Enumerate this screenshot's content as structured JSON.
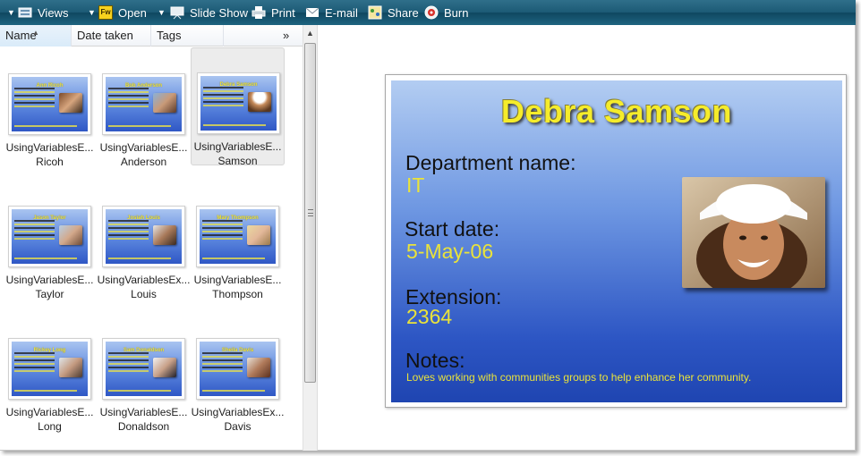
{
  "toolbar": {
    "views_label": "Views",
    "open_label": "Open",
    "slideshow_label": "Slide Show",
    "print_label": "Print",
    "email_label": "E-mail",
    "share_label": "Share",
    "burn_label": "Burn",
    "open_icon_text": "Fw"
  },
  "columns": {
    "name": "Name",
    "date_taken": "Date taken",
    "tags": "Tags",
    "more": "»"
  },
  "files": [
    {
      "line1": "UsingVariablesE...",
      "line2": "Ricoh",
      "thumb_name": "Ann Ricoh",
      "selected": false
    },
    {
      "line1": "UsingVariablesE...",
      "line2": "Anderson",
      "thumb_name": "Bob Anderson",
      "selected": false
    },
    {
      "line1": "UsingVariablesE...",
      "line2": "Samson",
      "thumb_name": "Debra Samson",
      "selected": true
    },
    {
      "line1": "UsingVariablesE...",
      "line2": "Taylor",
      "thumb_name": "Jason Taylor",
      "selected": false
    },
    {
      "line1": "UsingVariablesEx...",
      "line2": "Louis",
      "thumb_name": "Josiah Louis",
      "selected": false
    },
    {
      "line1": "UsingVariablesE...",
      "line2": "Thompson",
      "thumb_name": "Mary Thompson",
      "selected": false
    },
    {
      "line1": "UsingVariablesE...",
      "line2": "Long",
      "thumb_name": "Rickey Long",
      "selected": false
    },
    {
      "line1": "UsingVariablesE...",
      "line2": "Donaldson",
      "thumb_name": "Sam Donaldson",
      "selected": false
    },
    {
      "line1": "UsingVariablesEx...",
      "line2": "Davis",
      "thumb_name": "Sheila Davis",
      "selected": false
    }
  ],
  "preview": {
    "name": "Debra Samson",
    "department_label": "Department name:",
    "department_value": "IT",
    "start_label": "Start date:",
    "start_value": "5-May-06",
    "extension_label": "Extension:",
    "extension_value": "2364",
    "notes_label": "Notes:",
    "notes_value": "Loves working with communities groups to help enhance her community."
  },
  "colors": {
    "toolbar": "#1c5a75",
    "title_yellow": "#f5ec2b",
    "value_yellow": "#eae33a",
    "card_blue": "#2d56c4"
  }
}
